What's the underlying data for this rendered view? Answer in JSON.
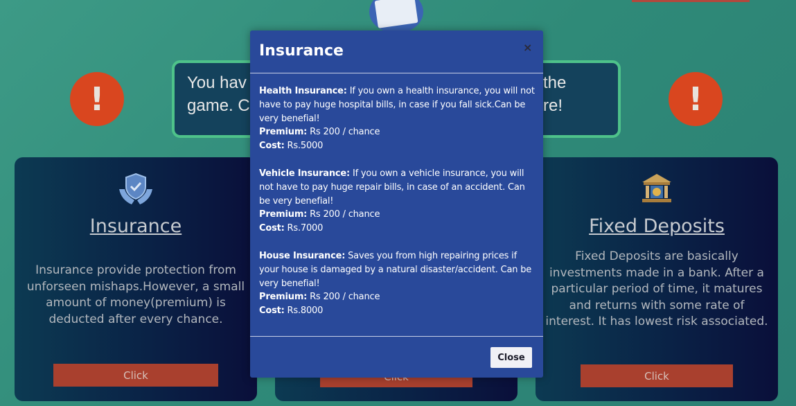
{
  "banner": {
    "left_line1": "You hav",
    "left_line2": "game. C",
    "right_line1": "the",
    "right_line2": "re!"
  },
  "alerts": {
    "icon": "exclamation-icon",
    "glyph": "!"
  },
  "cards": [
    {
      "icon": "shield-hands-icon",
      "title": "Insurance",
      "description": "Insurance provide protection from unforseen mishaps.However, a small amount of money(premium) is deducted after every chance.",
      "button": "Click"
    },
    {
      "button": "Click"
    },
    {
      "icon": "bank-icon",
      "title": "Fixed Deposits",
      "description": "Fixed Deposits are basically investments made in a bank. After a particular period of time, it matures and returns with some rate of interest. It has lowest risk associated.",
      "button": "Click"
    }
  ],
  "modal": {
    "title": "Insurance",
    "close_x": "×",
    "items": [
      {
        "name": "Health Insurance:",
        "text": " If you own a health insurance, you will not have to pay huge hospital bills, in case if you fall sick.Can be very benefial!",
        "premium_label": "Premium:",
        "premium_value": " Rs 200 / chance",
        "cost_label": "Cost:",
        "cost_value": " Rs.5000"
      },
      {
        "name": "Vehicle Insurance:",
        "text": " If you own a vehicle insurance, you will not have to pay huge repair bills, in case of an accident. Can be very benefial!",
        "premium_label": "Premium:",
        "premium_value": " Rs 200 / chance",
        "cost_label": "Cost:",
        "cost_value": " Rs.7000"
      },
      {
        "name": "House Insurance:",
        "text": " Saves you from high repairing prices if your house is damaged by a natural disaster/accident. Can be very benefial!",
        "premium_label": "Premium:",
        "premium_value": " Rs 200 / chance",
        "cost_label": "Cost:",
        "cost_value": " Rs.8000"
      }
    ],
    "close_button": "Close"
  },
  "colors": {
    "background": "#3d9a86",
    "modal": "#29499a",
    "alert": "#d9461f",
    "card_button": "#a9402e",
    "banner_border": "#4ec28a"
  }
}
